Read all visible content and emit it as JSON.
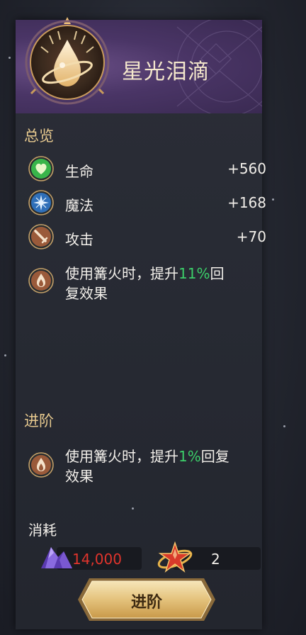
{
  "item": {
    "name": "星光泪滴",
    "emblem_icon": "starlight-teardrop-icon"
  },
  "overview": {
    "title": "总览",
    "stats": [
      {
        "label": "生命",
        "value": "+560",
        "icon": "heart-icon",
        "color": "#39b54a"
      },
      {
        "label": "魔法",
        "value": "+168",
        "icon": "star-burst-icon",
        "color": "#2f6fb8"
      },
      {
        "label": "攻击",
        "value": "+70",
        "icon": "sword-icon",
        "color": "#9a5a3a"
      }
    ],
    "effect": {
      "prefix": "使用篝火时，提升",
      "highlight": "11%",
      "suffix_line1": "回",
      "line2": "复效果",
      "icon": "campfire-icon"
    }
  },
  "advance": {
    "title": "进阶",
    "effect": {
      "prefix": "使用篝火时，提升",
      "highlight": "1%",
      "suffix_line1": "回复",
      "line2": "效果",
      "icon": "campfire-icon"
    }
  },
  "cost": {
    "label": "消耗",
    "crystal": {
      "amount": "14,000",
      "icon": "purple-crystal-icon",
      "color": "#e0342c"
    },
    "star_token": {
      "amount": "2",
      "icon": "red-star-icon"
    }
  },
  "button": {
    "label": "进阶"
  },
  "colors": {
    "accent_gold": "#e7c98f",
    "highlight_green": "#3ccf6a",
    "header_purple": "#4a3566"
  }
}
